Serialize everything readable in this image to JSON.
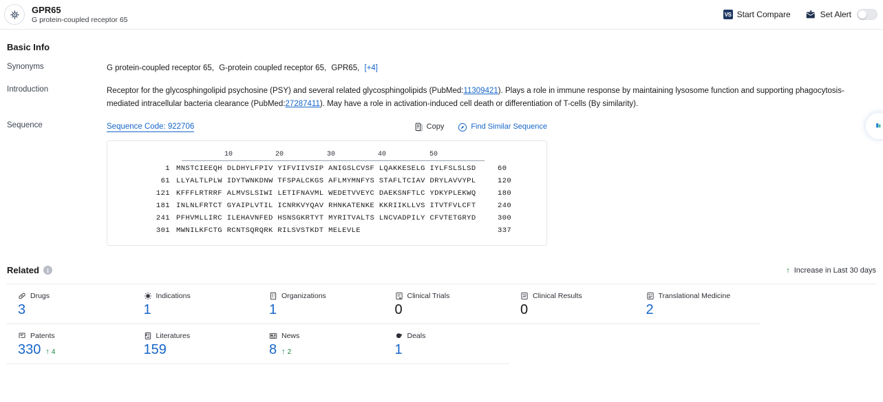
{
  "header": {
    "logo_icon": "target-crosshair-icon",
    "gene_symbol": "GPR65",
    "gene_name": "G protein-coupled receptor 65",
    "start_compare_label": "Start Compare",
    "start_compare_icon_text": "VS",
    "set_alert_label": "Set Alert",
    "alert_icon": "envelope-up-arrow-icon",
    "alert_toggle_state": "off"
  },
  "basic_info": {
    "section_title": "Basic Info",
    "synonyms_label": "Synonyms",
    "synonyms": [
      "G protein-coupled receptor 65,",
      "G-protein coupled receptor 65,",
      "GPR65,"
    ],
    "synonyms_more": "[+4]",
    "introduction_label": "Introduction",
    "introduction_parts": {
      "p1": "Receptor for the glycosphingolipid psychosine (PSY) and several related glycosphingolipids (PubMed:",
      "link1": "11309421",
      "p2": "). Plays a role in immune response by maintaining lysosome function and supporting phagocytosis-mediated intracellular bacteria clearance (PubMed:",
      "link2": "27287411",
      "p3": "). May have a role in activation-induced cell death or differentiation of T-cells (By similarity)."
    }
  },
  "sequence": {
    "label": "Sequence",
    "code_label": "Sequence Code: 922706",
    "copy_label": "Copy",
    "copy_icon": "copy-icon",
    "find_similar_label": "Find Similar Sequence",
    "find_similar_icon": "compass-search-icon",
    "ruler_ticks": [
      "10",
      "20",
      "30",
      "40",
      "50"
    ],
    "lines": [
      {
        "start": "1",
        "chunks": "MNSTCIEEQH DLDHYLFPIV YIFVIIVSIP ANIGSLCVSF LQAKKESELG IYLFSLSLSD",
        "end": "60"
      },
      {
        "start": "61",
        "chunks": "LLYALTLPLW IDYTWNKDNW TFSPALCKGS AFLMYMNFYS STAFLTCIAV DRYLAVVYPL",
        "end": "120"
      },
      {
        "start": "121",
        "chunks": "KFFFLRTRRF ALMVSLSIWI LETIFNAVML WEDETVVEYC DAEKSNFTLC YDKYPLEKWQ",
        "end": "180"
      },
      {
        "start": "181",
        "chunks": "INLNLFRTCT GYAIPLVTIL ICNRKVYQAV RHNKATENKE KKRIIKLLVS ITVTFVLCFT",
        "end": "240"
      },
      {
        "start": "241",
        "chunks": "PFHVMLLIRC ILEHAVNFED HSNSGKRTYT MYRITVALTS LNCVADPILY CFVTETGRYD",
        "end": "300"
      },
      {
        "start": "301",
        "chunks": "MWNILKFCTG RCNTSQRQRK RILSVSTKDT MELEVLE",
        "end": "337"
      }
    ]
  },
  "related": {
    "title": "Related",
    "info_icon": "info-icon",
    "increase_note": "Increase in Last 30 days",
    "increase_arrow": "up-arrow-icon",
    "cards": [
      {
        "label": "Drugs",
        "icon": "capsule-icon",
        "value": "3",
        "delta": "",
        "zero": false
      },
      {
        "label": "Indications",
        "icon": "virus-icon",
        "value": "1",
        "delta": "",
        "zero": false
      },
      {
        "label": "Organizations",
        "icon": "building-icon",
        "value": "1",
        "delta": "",
        "zero": false
      },
      {
        "label": "Clinical Trials",
        "icon": "clipboard-icon",
        "value": "0",
        "delta": "",
        "zero": true
      },
      {
        "label": "Clinical Results",
        "icon": "results-doc-icon",
        "value": "0",
        "delta": "",
        "zero": true
      },
      {
        "label": "Translational Medicine",
        "icon": "translational-icon",
        "value": "2",
        "delta": "",
        "zero": false
      },
      {
        "label": "Patents",
        "icon": "patent-icon",
        "value": "330",
        "delta": "4",
        "zero": false
      },
      {
        "label": "Literatures",
        "icon": "book-icon",
        "value": "159",
        "delta": "",
        "zero": false
      },
      {
        "label": "News",
        "icon": "newspaper-icon",
        "value": "8",
        "delta": "2",
        "zero": false
      },
      {
        "label": "Deals",
        "icon": "handshake-icon",
        "value": "1",
        "delta": "",
        "zero": false
      }
    ]
  },
  "side_fab": {
    "icon": "feedback-icon"
  }
}
